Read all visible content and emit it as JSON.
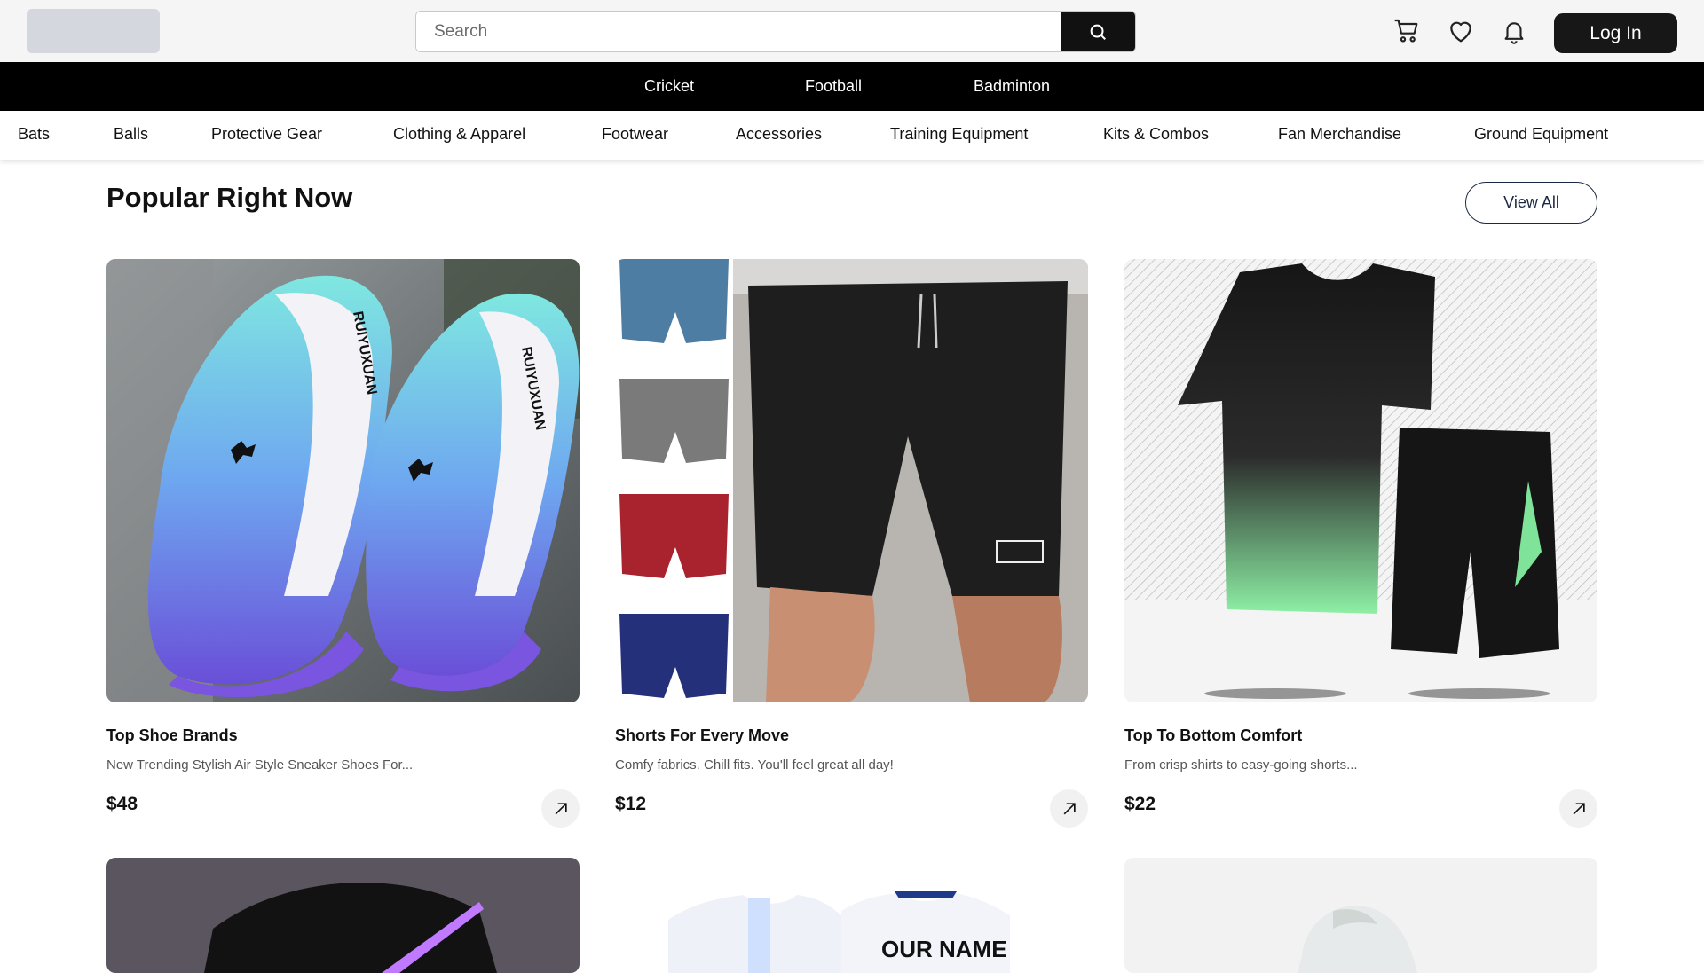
{
  "header": {
    "search_placeholder": "Search",
    "login_label": "Log In",
    "icons": [
      "cart-icon",
      "heart-icon",
      "bell-icon",
      "search-icon"
    ]
  },
  "sports": [
    "Cricket",
    "Football",
    "Badminton"
  ],
  "categories": [
    "Bats",
    "Balls",
    "Protective Gear",
    "Clothing & Apparel",
    "Footwear",
    "Accessories",
    "Training Equipment",
    "Kits & Combos",
    "Fan Merchandise",
    "Ground Equipment"
  ],
  "section": {
    "title": "Popular Right Now",
    "view_all": "View All"
  },
  "products": [
    {
      "title": "Top Shoe Brands",
      "desc": "New Trending Stylish Air Style Sneaker Shoes For...",
      "price": "$48"
    },
    {
      "title": "Shorts For Every Move",
      "desc": "Comfy fabrics. Chill fits. You'll feel great all day!",
      "price": "$12"
    },
    {
      "title": "Top To Bottom Comfort",
      "desc": "From crisp shirts to easy-going shorts...",
      "price": "$22"
    }
  ],
  "image_text": {
    "shoe_brand": "RUIYUXUAN",
    "jersey_name": "OUR NAME"
  },
  "colors": {
    "accent": "#111111",
    "sportsbar": "#000000",
    "viewall_border": "#1b2a44"
  }
}
